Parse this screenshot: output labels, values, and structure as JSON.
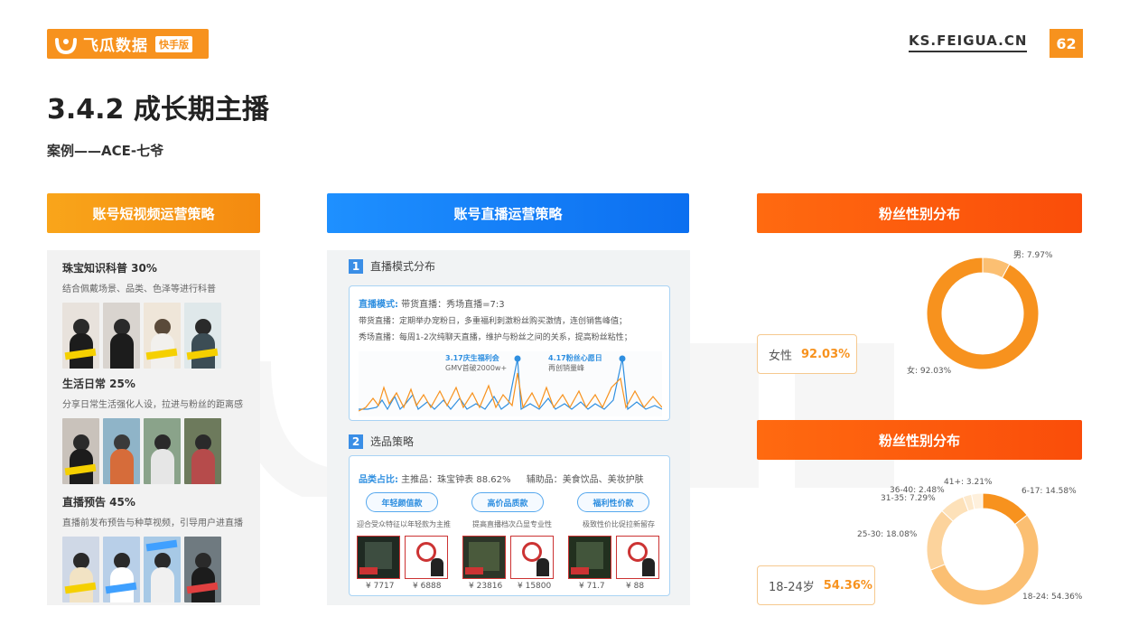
{
  "header": {
    "logo_text": "飞瓜数据",
    "logo_badge": "快手版",
    "site": "KS.FEIGUA.CN",
    "page_number": "62"
  },
  "title": "3.4.2 成长期主播",
  "subtitle": "案例——ACE-七爷",
  "col1": {
    "header": "账号短视频运营策略",
    "sections": [
      {
        "title": "珠宝知识科普   30%",
        "desc": "结合佩戴场景、品类、色泽等进行科普"
      },
      {
        "title": "生活日常  25%",
        "desc": "分享日常生活强化人设，拉进与粉丝的距离感"
      },
      {
        "title": "直播预告 45%",
        "desc": "直播前发布预告与种草视频，引导用户进直播"
      }
    ]
  },
  "col2": {
    "header": "账号直播运营策略",
    "sec1": {
      "num": "1",
      "title": "直播模式分布",
      "mode_label": "直播模式:",
      "mode_value": " 带货直播：秀场直播=7:3",
      "line2": "带货直播：定期举办宠粉日，多重福利刺激粉丝购买激情，连创销售峰值；",
      "line3": "秀场直播：每周1-2次纯聊天直播，维护与粉丝之间的关系，提高粉丝粘性；",
      "ann1_title": "3.17庆生福利会",
      "ann1_sub": "GMV首破2000w+",
      "ann2_title": "4.17粉丝心愿日",
      "ann2_sub": "再创销量峰"
    },
    "sec2": {
      "num": "2",
      "title": "选品策略",
      "cat_label": "品类占比:",
      "cat_main": " 主推品：珠宝钟表 88.62%",
      "cat_aux_label": "辅助品：",
      "cat_aux": "美食饮品、美妆护肤",
      "pills": [
        "年轻颜值款",
        "高价品质款",
        "福利性价款"
      ],
      "descs": [
        "迎合受众特征以年轻款为主推",
        "提高直播档次凸显专业性",
        "极致性价比促拉新留存"
      ],
      "prices": [
        "¥ 7717",
        "¥ 6888",
        "¥ 23816",
        "¥ 15800",
        "¥ 71.7",
        "¥ 88"
      ]
    }
  },
  "col3": {
    "header1": "粉丝性别分布",
    "gender_stat_label": "女性",
    "gender_stat_value": "92.03%",
    "gender_labels": [
      "男: 7.97%",
      "女: 92.03%"
    ],
    "header2": "粉丝性别分布",
    "age_stat_label": "18-24岁",
    "age_stat_value": "54.36%",
    "age_labels": [
      "41+: 3.21%",
      "36-40: 2.48%",
      "31-35: 7.29%",
      "25-30: 18.08%",
      "6-17: 14.58%",
      "18-24: 54.36%"
    ]
  },
  "chart_data": [
    {
      "type": "pie",
      "labels": [
        "男",
        "女"
      ],
      "values": [
        7.97,
        92.03
      ],
      "colors": [
        "#fbbf72",
        "#f7921e"
      ]
    },
    {
      "type": "pie",
      "labels": [
        "6-17",
        "18-24",
        "25-30",
        "31-35",
        "36-40",
        "41+"
      ],
      "values": [
        14.58,
        54.36,
        18.08,
        7.29,
        2.48,
        3.21
      ],
      "colors": [
        "#f7921e",
        "#fbbf72",
        "#fcd39c",
        "#fde1b9",
        "#fde9cc",
        "#fef0dc"
      ]
    }
  ],
  "colors": {
    "orange": "#f7921e",
    "blue": "#2f8fe0",
    "red_orange": "#fa4d0a"
  }
}
